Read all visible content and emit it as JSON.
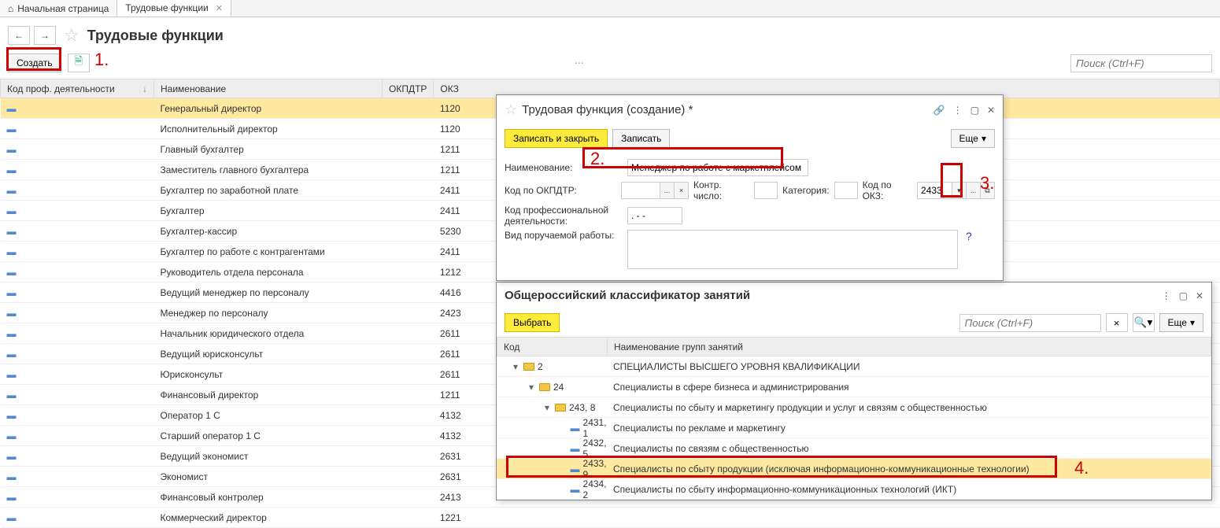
{
  "tabs": {
    "home": "Начальная страница",
    "current": "Трудовые функции"
  },
  "page_title": "Трудовые функции",
  "toolbar": {
    "create": "Создать"
  },
  "search_placeholder": "Поиск (Ctrl+F)",
  "columns": {
    "code": "Код проф. деятельности",
    "name": "Наименование",
    "okpdtr": "ОКПДТР",
    "okz": "ОКЗ"
  },
  "rows": [
    {
      "name": "Генеральный директор",
      "okz": "1120",
      "sel": true
    },
    {
      "name": "Исполнительный директор",
      "okz": "1120"
    },
    {
      "name": "Главный бухгалтер",
      "okz": "1211"
    },
    {
      "name": "Заместитель главного бухгалтера",
      "okz": "1211"
    },
    {
      "name": "Бухгалтер по заработной плате",
      "okz": "2411"
    },
    {
      "name": "Бухгалтер",
      "okz": "2411"
    },
    {
      "name": "Бухгалтер-кассир",
      "okz": "5230"
    },
    {
      "name": "Бухгалтер по работе с контрагентами",
      "okz": "2411"
    },
    {
      "name": "Руководитель отдела персонала",
      "okz": "1212"
    },
    {
      "name": "Ведущий менеджер по персоналу",
      "okz": "4416"
    },
    {
      "name": "Менеджер по персоналу",
      "okz": "2423"
    },
    {
      "name": "Начальник юридического отдела",
      "okz": "2611"
    },
    {
      "name": "Ведущий юрисконсульт",
      "okz": "2611"
    },
    {
      "name": "Юрисконсульт",
      "okz": "2611"
    },
    {
      "name": "Финансовый директор",
      "okz": "1211"
    },
    {
      "name": "Оператор 1 С",
      "okz": "4132"
    },
    {
      "name": "Старший оператор 1 С",
      "okz": "4132"
    },
    {
      "name": "Ведущий экономист",
      "okz": "2631"
    },
    {
      "name": "Экономист",
      "okz": "2631"
    },
    {
      "name": "Финансовый контролер",
      "okz": "2413"
    },
    {
      "name": "Коммерческий директор",
      "okz": "1221"
    }
  ],
  "dialog": {
    "title": "Трудовая функция (создание) *",
    "save_close": "Записать и закрыть",
    "save": "Записать",
    "more": "Еще",
    "labels": {
      "name": "Наименование:",
      "okpdtr": "Код по ОКПДТР:",
      "check": "Контр. число:",
      "category": "Категория:",
      "okz": "Код по ОКЗ:",
      "prof": "Код профессиональной деятельности:",
      "work": "Вид поручаемой работы:"
    },
    "name_value": "Менеджер по работе с маркетплейсом",
    "okz_value": "2433",
    "prof_value": ". - -"
  },
  "classifier": {
    "title": "Общероссийский классификатор занятий",
    "select": "Выбрать",
    "more": "Еще",
    "cols": {
      "code": "Код",
      "name": "Наименование групп занятий"
    },
    "tree": [
      {
        "level": 0,
        "folder": true,
        "open": true,
        "code": "2",
        "name": "СПЕЦИАЛИСТЫ ВЫСШЕГО УРОВНЯ КВАЛИФИКАЦИИ"
      },
      {
        "level": 1,
        "folder": true,
        "open": true,
        "code": "24",
        "name": "Специалисты в сфере бизнеса и администрирования"
      },
      {
        "level": 2,
        "folder": true,
        "open": true,
        "code": "243, 8",
        "name": "Специалисты по сбыту и маркетингу продукции и услуг и связям с общественностью"
      },
      {
        "level": 3,
        "folder": false,
        "code": "2431, 1",
        "name": "Специалисты по рекламе и маркетингу"
      },
      {
        "level": 3,
        "folder": false,
        "code": "2432, 5",
        "name": "Специалисты по связям с общественностью"
      },
      {
        "level": 3,
        "folder": false,
        "code": "2433, 9",
        "name": "Специалисты по сбыту продукции (исключая информационно-коммуникационные технологии)",
        "hl": true
      },
      {
        "level": 3,
        "folder": false,
        "code": "2434, 2",
        "name": "Специалисты по сбыту информационно-коммуникационных технологий (ИКТ)"
      }
    ]
  },
  "annotations": {
    "a1": "1.",
    "a2": "2.",
    "a3": "3.",
    "a4": "4."
  }
}
